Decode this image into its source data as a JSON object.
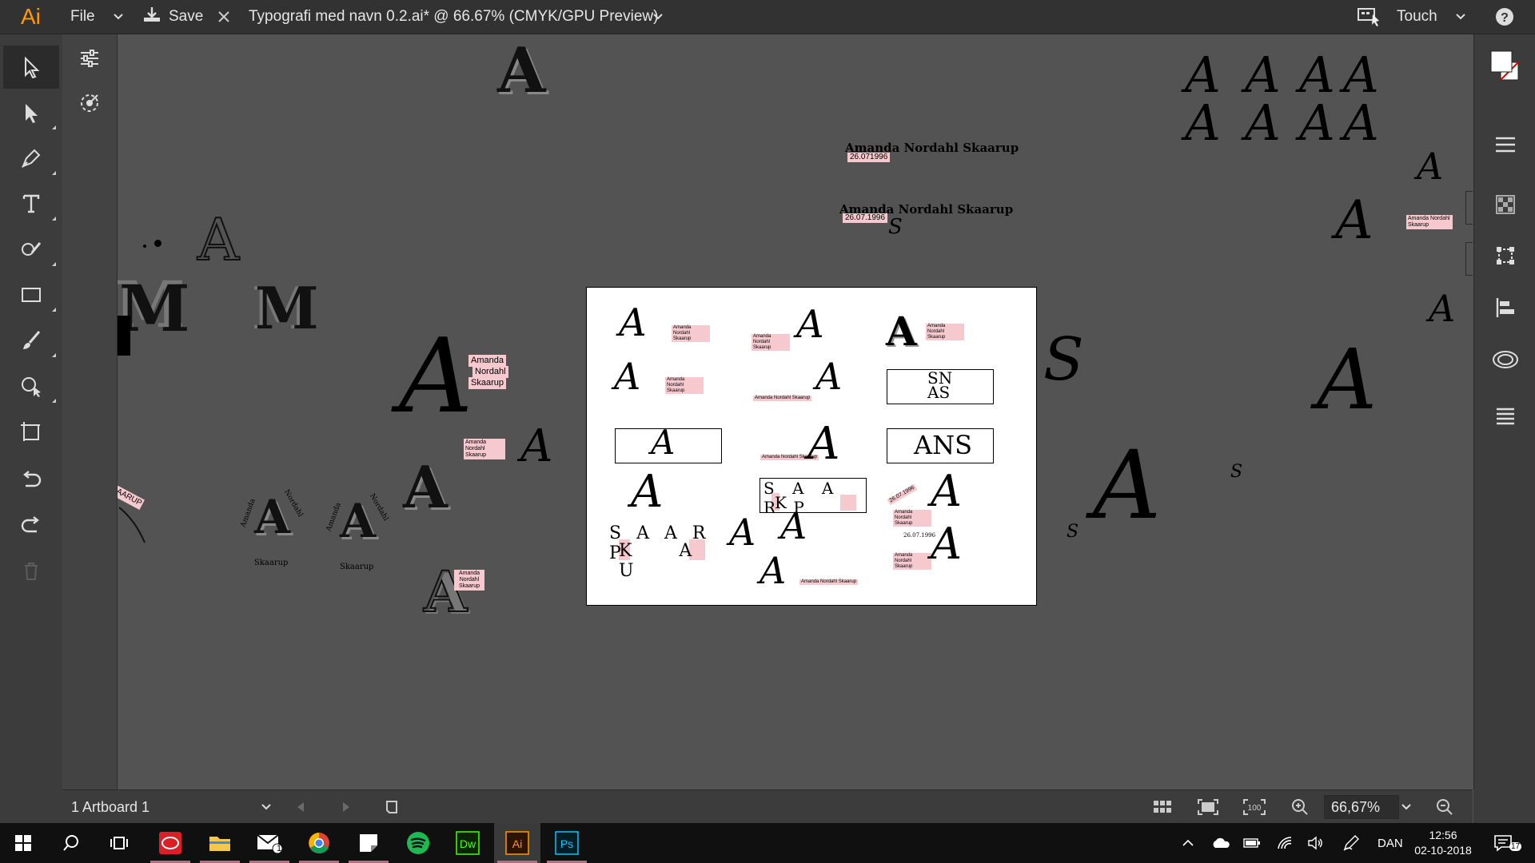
{
  "app": {
    "logo": "Ai",
    "accent": "#ff9a00"
  },
  "menu": {
    "file_label": "File",
    "save_label": "Save",
    "doc_title": "Typografi med navn 0.2.ai* @ 66.67% (CMYK/GPU Preview)"
  },
  "workspace": {
    "label": "Touch"
  },
  "statusbar": {
    "artboard_label": "1 Artboard 1",
    "zoom_value": "66,67%"
  },
  "taskbar": {
    "mail_badge": "1",
    "notif_badge": "17",
    "language": "DAN",
    "time": "12:56",
    "date": "02-10-2018"
  },
  "canvas_text": {
    "name_line": "Amanda Nordahl Skaarup",
    "date_a": "26.071996",
    "date_b": "26.07.1996",
    "side_name": "Amanda Nordahl Skaarup",
    "label_amanda": "Amanda",
    "label_nordahl": "Nordahl",
    "label_skaarup": "Skaarup",
    "curved_fragment": "AARUP",
    "ring_word_1": "Amanda",
    "ring_word_2": "Nordahl",
    "ring_word_3": "Skaarup",
    "monogram_letter": "A",
    "monogram_m": "M",
    "swash_s": "S"
  },
  "artboard": {
    "name_small": "Amanda Nordahl Skaarup",
    "date_small": "26.07.1996",
    "ans": "ANS",
    "ans_stacked_1": "SN",
    "ans_stacked_2": "AS",
    "scrambled_top": "S A A R P",
    "scrambled_bottom": "K A U",
    "amanda": "Amanda",
    "nordahl_skaarup": "Nordahl Skaarup",
    "date_rot": "26.07.1996"
  }
}
